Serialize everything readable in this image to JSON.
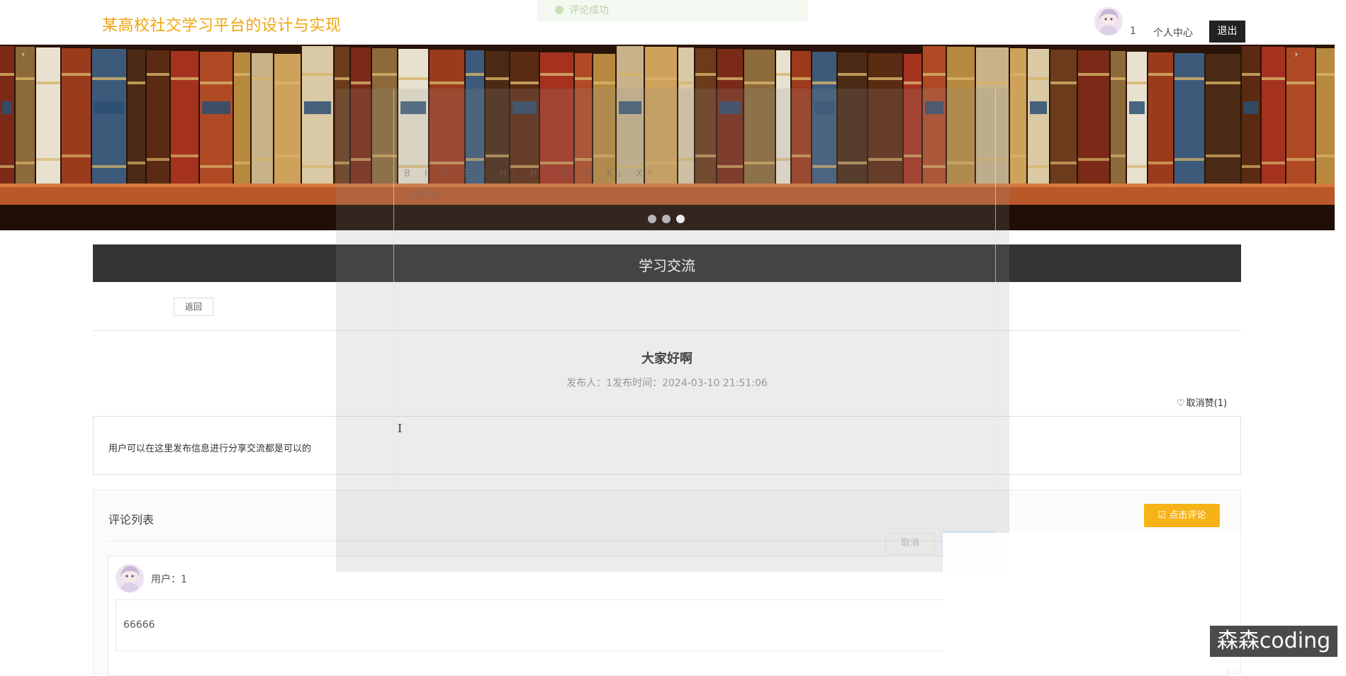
{
  "header": {
    "site_title": "某高校社交学习平台的设计与实现",
    "toast_text": "评论成功",
    "user_number": "1",
    "personal_center": "个人中心",
    "logout": "退出"
  },
  "banner": {
    "prev_arrow": "‹",
    "next_arrow": "›",
    "dots": 3,
    "active_dot": 3
  },
  "section": {
    "title": "学习交流"
  },
  "post": {
    "back_label": "返回",
    "title": "大家好啊",
    "meta": "发布人：1发布时间：2024-03-10 21:51:06",
    "like_label": "取消赞(1)",
    "content": "用户可以在这里发布信息进行分享交流都是可以的"
  },
  "comments": {
    "title": "评论列表",
    "comment_button": "点击评论",
    "items": [
      {
        "user": "用户：1",
        "text": "66666"
      }
    ]
  },
  "modal": {
    "toolbar": "B I U S Ⅰ H₁ H₂ ☰ ☰ X₂ X²",
    "font": "标准字体",
    "cancel": "取消"
  },
  "watermark": "森森coding",
  "colors": {
    "accent": "#f0a50b",
    "section_bg": "#333333",
    "comment_button": "#f5b318"
  }
}
